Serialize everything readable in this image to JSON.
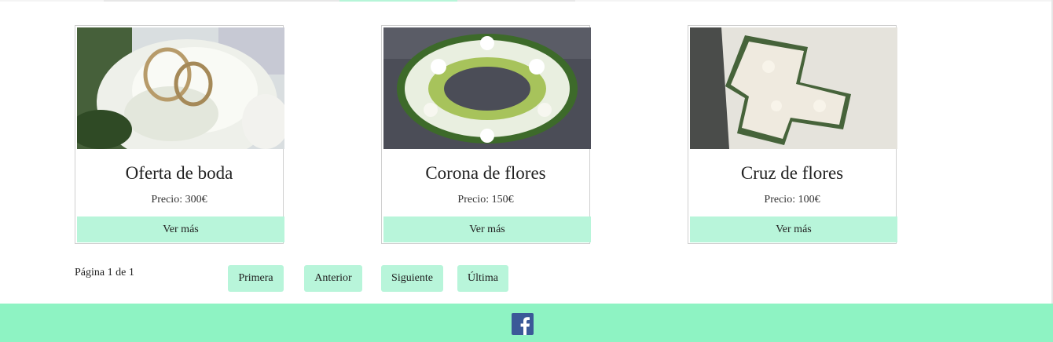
{
  "products": [
    {
      "title": "Oferta de boda",
      "price": "Precio: 300€",
      "button": "Ver más",
      "image_icon": "wedding-rings-rose-image"
    },
    {
      "title": "Corona de flores",
      "price": "Precio: 150€",
      "button": "Ver más",
      "image_icon": "flower-wreath-image"
    },
    {
      "title": "Cruz de flores",
      "price": "Precio: 100€",
      "button": "Ver más",
      "image_icon": "flower-cross-image"
    }
  ],
  "pagination": {
    "info": "Página 1 de 1",
    "first": "Primera",
    "prev": "Anterior",
    "next": "Siguiente",
    "last": "Última"
  },
  "footer": {
    "social_icon": "facebook-icon"
  },
  "colors": {
    "accent": "#b8f5da",
    "footer": "#8ef3c3",
    "facebook": "#3b5998"
  }
}
